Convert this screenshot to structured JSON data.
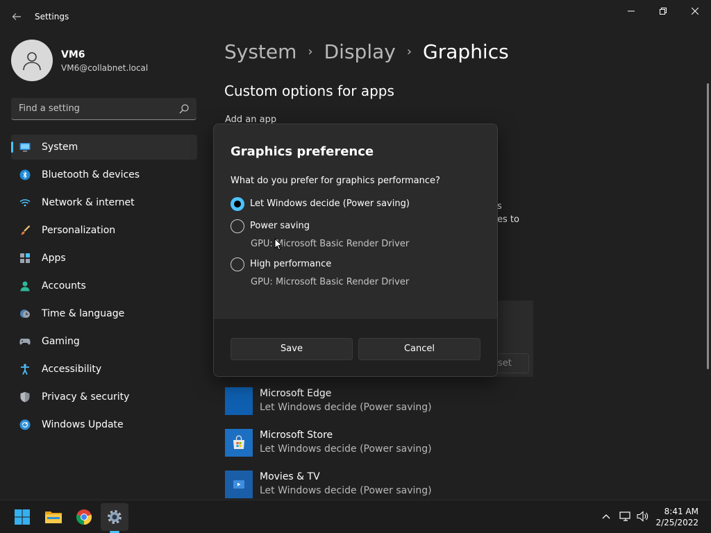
{
  "window": {
    "title": "Settings",
    "controls": {
      "minimize": "minimize-icon",
      "maximize": "restore-icon",
      "close": "close-icon"
    }
  },
  "profile": {
    "name": "VM6",
    "email": "VM6@collabnet.local"
  },
  "search": {
    "placeholder": "Find a setting",
    "value": ""
  },
  "sidebar": {
    "items": [
      {
        "label": "System",
        "icon": "monitor-icon",
        "selected": true
      },
      {
        "label": "Bluetooth & devices",
        "icon": "bluetooth-icon",
        "selected": false
      },
      {
        "label": "Network & internet",
        "icon": "wifi-icon",
        "selected": false
      },
      {
        "label": "Personalization",
        "icon": "brush-icon",
        "selected": false
      },
      {
        "label": "Apps",
        "icon": "apps-icon",
        "selected": false
      },
      {
        "label": "Accounts",
        "icon": "person-icon",
        "selected": false
      },
      {
        "label": "Time & language",
        "icon": "clock-globe-icon",
        "selected": false
      },
      {
        "label": "Gaming",
        "icon": "gamepad-icon",
        "selected": false
      },
      {
        "label": "Accessibility",
        "icon": "accessibility-icon",
        "selected": false
      },
      {
        "label": "Privacy & security",
        "icon": "shield-icon",
        "selected": false
      },
      {
        "label": "Windows Update",
        "icon": "update-icon",
        "selected": false
      }
    ]
  },
  "breadcrumb": {
    "items": [
      "System",
      "Display",
      "Graphics"
    ],
    "separator": "›"
  },
  "content": {
    "section_title": "Custom options for apps",
    "add_app_label": "Add an app",
    "obscured_fragments": {
      "line1": "s",
      "line2": "es to",
      "reset_fragment": "set"
    },
    "apps": [
      {
        "name": "Microsoft Edge",
        "preference": "Let Windows decide (Power saving)",
        "icon": "edge-icon"
      },
      {
        "name": "Microsoft Store",
        "preference": "Let Windows decide (Power saving)",
        "icon": "store-icon"
      },
      {
        "name": "Movies & TV",
        "preference": "Let Windows decide (Power saving)",
        "icon": "movies-tv-icon"
      }
    ]
  },
  "dialog": {
    "title": "Graphics preference",
    "question": "What do you prefer for graphics performance?",
    "options": [
      {
        "label": "Let Windows decide (Power saving)",
        "checked": true,
        "gpu": ""
      },
      {
        "label": "Power saving",
        "checked": false,
        "gpu": "GPU: Microsoft Basic Render Driver"
      },
      {
        "label": "High performance",
        "checked": false,
        "gpu": "GPU: Microsoft Basic Render Driver"
      }
    ],
    "save_label": "Save",
    "cancel_label": "Cancel"
  },
  "taskbar": {
    "apps": [
      {
        "name": "Start",
        "icon": "windows-start-icon",
        "active": false
      },
      {
        "name": "File Explorer",
        "icon": "folder-icon",
        "active": false
      },
      {
        "name": "Google Chrome",
        "icon": "chrome-icon",
        "active": false
      },
      {
        "name": "Settings",
        "icon": "gear-icon",
        "active": true
      }
    ],
    "tray": [
      "chevron-up-icon",
      "network-icon",
      "volume-icon"
    ],
    "time": "8:41 AM",
    "date": "2/25/2022"
  },
  "colors": {
    "accent": "#4cc2ff",
    "background": "#202020",
    "dialog": "#2b2b2b",
    "taskbar": "#1c1c1c"
  }
}
